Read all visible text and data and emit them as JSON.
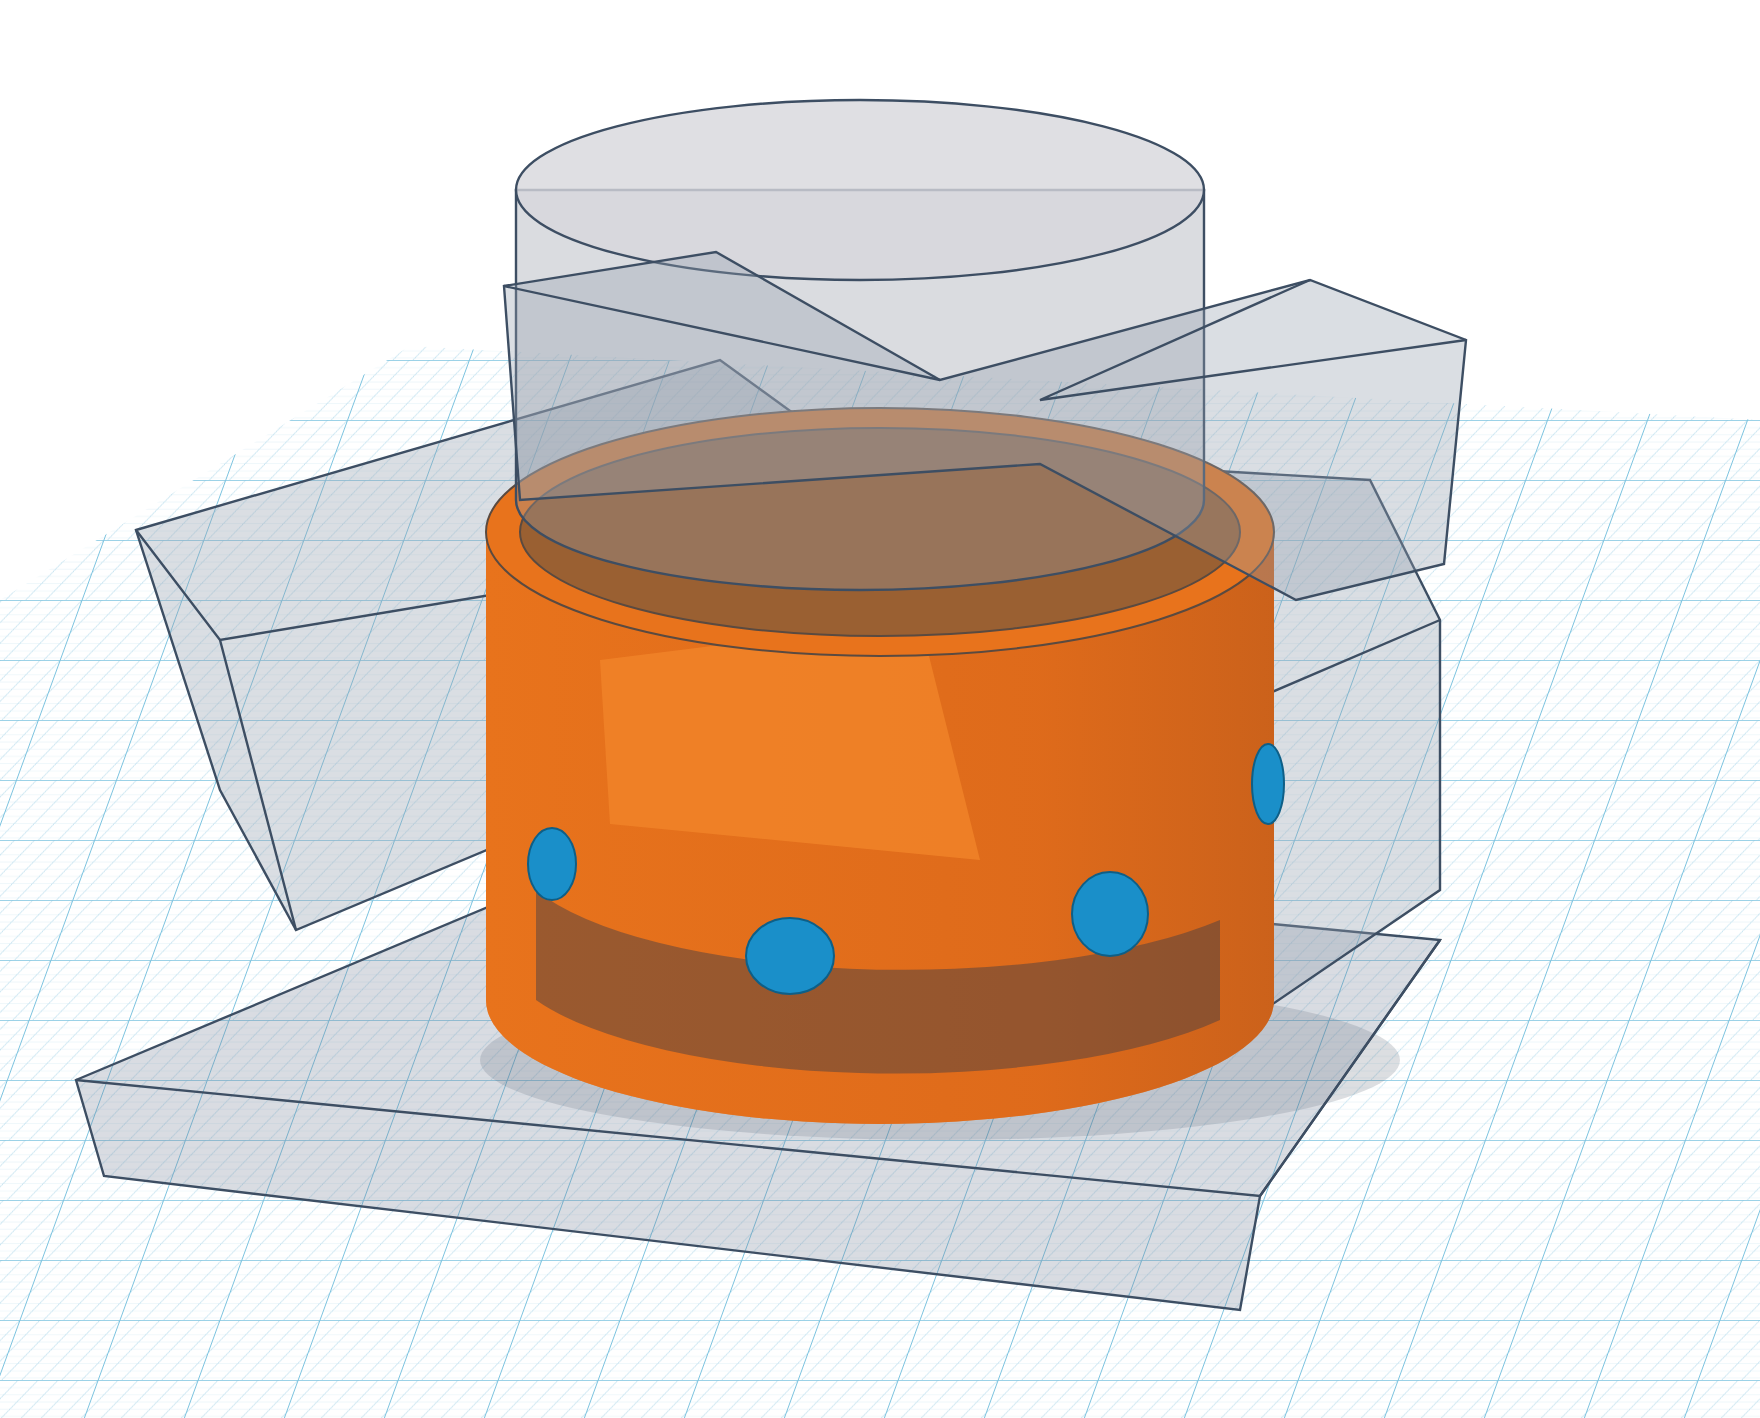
{
  "workplane": {
    "grid": true
  },
  "shapes": [
    {
      "kind": "hole-slab"
    },
    {
      "kind": "hole-box-left"
    },
    {
      "kind": "hole-box-right"
    },
    {
      "kind": "solid-cylinder",
      "color": "#e8731c"
    },
    {
      "kind": "hole-cylinder"
    },
    {
      "kind": "hole-box-back"
    },
    {
      "kind": "sphere",
      "color": "#1a8fc9"
    },
    {
      "kind": "sphere",
      "color": "#1a8fc9"
    },
    {
      "kind": "sphere",
      "color": "#1a8fc9"
    },
    {
      "kind": "sphere",
      "color": "#1a8fc9"
    }
  ]
}
